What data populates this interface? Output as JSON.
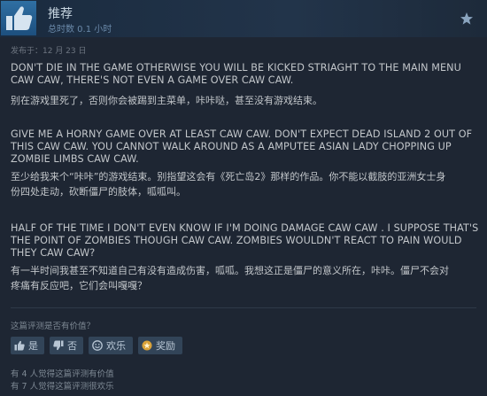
{
  "header": {
    "recommendation": "推荐",
    "hours": "总时数 0.1 小时"
  },
  "posted": "发布于：12 月 23 日",
  "paragraphs": [
    {
      "en": [
        "DON'T DIE IN THE GAME OTHERWISE YOU WILL BE KICKED STRIAGHT TO THE MAIN MENU",
        "CAW CAW, THERE'S NOT EVEN A GAME OVER CAW CAW."
      ],
      "zh": [
        "别在游戏里死了，否则你会被踢到主菜单，咔咔哒，甚至没有游戏结束。"
      ]
    },
    {
      "en": [
        "GIVE ME A HORNY GAME OVER AT LEAST CAW CAW. DON'T EXPECT DEAD ISLAND 2 OUT OF",
        "THIS CAW CAW. YOU CANNOT WALK AROUND AS A AMPUTEE ASIAN LADY CHOPPING UP",
        "ZOMBIE LIMBS CAW CAW."
      ],
      "zh": [
        "至少给我来个“咔咔”的游戏结束。别指望这会有《死亡岛2》那样的作品。你不能以截肢的亚洲女士身",
        "份四处走动，砍断僵尸的肢体，呱呱叫。"
      ]
    },
    {
      "en": [
        "HALF OF THE TIME I DON'T EVEN KNOW IF I'M DOING DAMAGE CAW CAW . I SUPPOSE THAT'S",
        "THE POINT OF ZOMBIES THOUGH CAW CAW. ZOMBIES WOULDN'T REACT TO PAIN WOULD",
        "THEY CAW CAW?"
      ],
      "zh": [
        "有一半时间我甚至不知道自己有没有造成伤害，呱呱。我想这正是僵尸的意义所在，咔咔。僵尸不会对",
        "疼痛有反应吧，它们会叫嘎嘎？"
      ]
    }
  ],
  "helpful_question": "这篇评测是否有价值？",
  "buttons": {
    "yes": "是",
    "no": "否",
    "funny": "欢乐",
    "award": "奖励"
  },
  "counts": {
    "helpful": "有 4 人觉得这篇评测有价值",
    "funny": "有 7 人觉得这篇评测很欢乐"
  }
}
